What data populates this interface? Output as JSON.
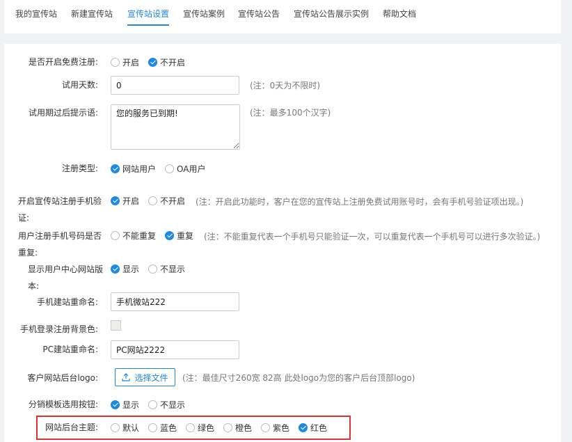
{
  "tabs": [
    {
      "label": "我的宣传站"
    },
    {
      "label": "新建宣传站"
    },
    {
      "label": "宣传站设置"
    },
    {
      "label": "宣传站案例"
    },
    {
      "label": "宣传站公告"
    },
    {
      "label": "宣传站公告展示实例"
    },
    {
      "label": "帮助文档"
    }
  ],
  "active_tab": "宣传站设置",
  "form": {
    "free_register": {
      "label": "是否开启免费注册:",
      "options": [
        "开启",
        "不开启"
      ],
      "selected": "不开启"
    },
    "trial_days": {
      "label": "试用天数:",
      "value": "0",
      "note": "(注：0天为不限时)"
    },
    "trial_expired_msg": {
      "label": "试用期过后提示语:",
      "value": "您的服务已到期!",
      "note": "(注：最多100个汉字)"
    },
    "register_type": {
      "label": "注册类型:",
      "options": [
        "网站用户",
        "OA用户"
      ],
      "selected": "网站用户"
    },
    "phone_verify": {
      "label": "开启宣传站注册手机验证:",
      "options": [
        "开启",
        "不开启"
      ],
      "selected": "开启",
      "note": "(注：开启此功能时，客户在您的宣传站上注册免费试用账号时，会有手机号验证项出现。)"
    },
    "phone_repeat": {
      "label": "用户注册手机号码是否重复:",
      "options": [
        "不能重复",
        "重复"
      ],
      "selected": "重复",
      "note": "(注：不能重复代表一个手机号只能验证一次，可以重复代表一个手机号可以进行多次验证。)"
    },
    "show_version": {
      "label": "显示用户中心网站版本:",
      "options": [
        "显示",
        "不显示"
      ],
      "selected": "显示"
    },
    "mobile_rename": {
      "label": "手机建站重命名:",
      "value": "手机微站222"
    },
    "mobile_bg": {
      "label": "手机登录注册背景色:",
      "color": "#eeeee8"
    },
    "pc_rename": {
      "label": "PC建站重命名:",
      "value": "PC网站2222"
    },
    "client_logo": {
      "label": "客户网站后台logo:",
      "button": "选择文件",
      "note": "(注：最佳尺寸260宽 82高 此处logo为您的客户后台顶部logo)"
    },
    "distribution_btn": {
      "label": "分销模板选用按钮:",
      "options": [
        "显示",
        "不显示"
      ],
      "selected": "显示"
    },
    "admin_theme": {
      "label": "网站后台主题:",
      "options": [
        "默认",
        "蓝色",
        "绿色",
        "橙色",
        "紫色",
        "红色"
      ],
      "selected": "红色"
    }
  },
  "colors": {
    "accent": "#1e88e5",
    "highlight": "#e03131"
  }
}
